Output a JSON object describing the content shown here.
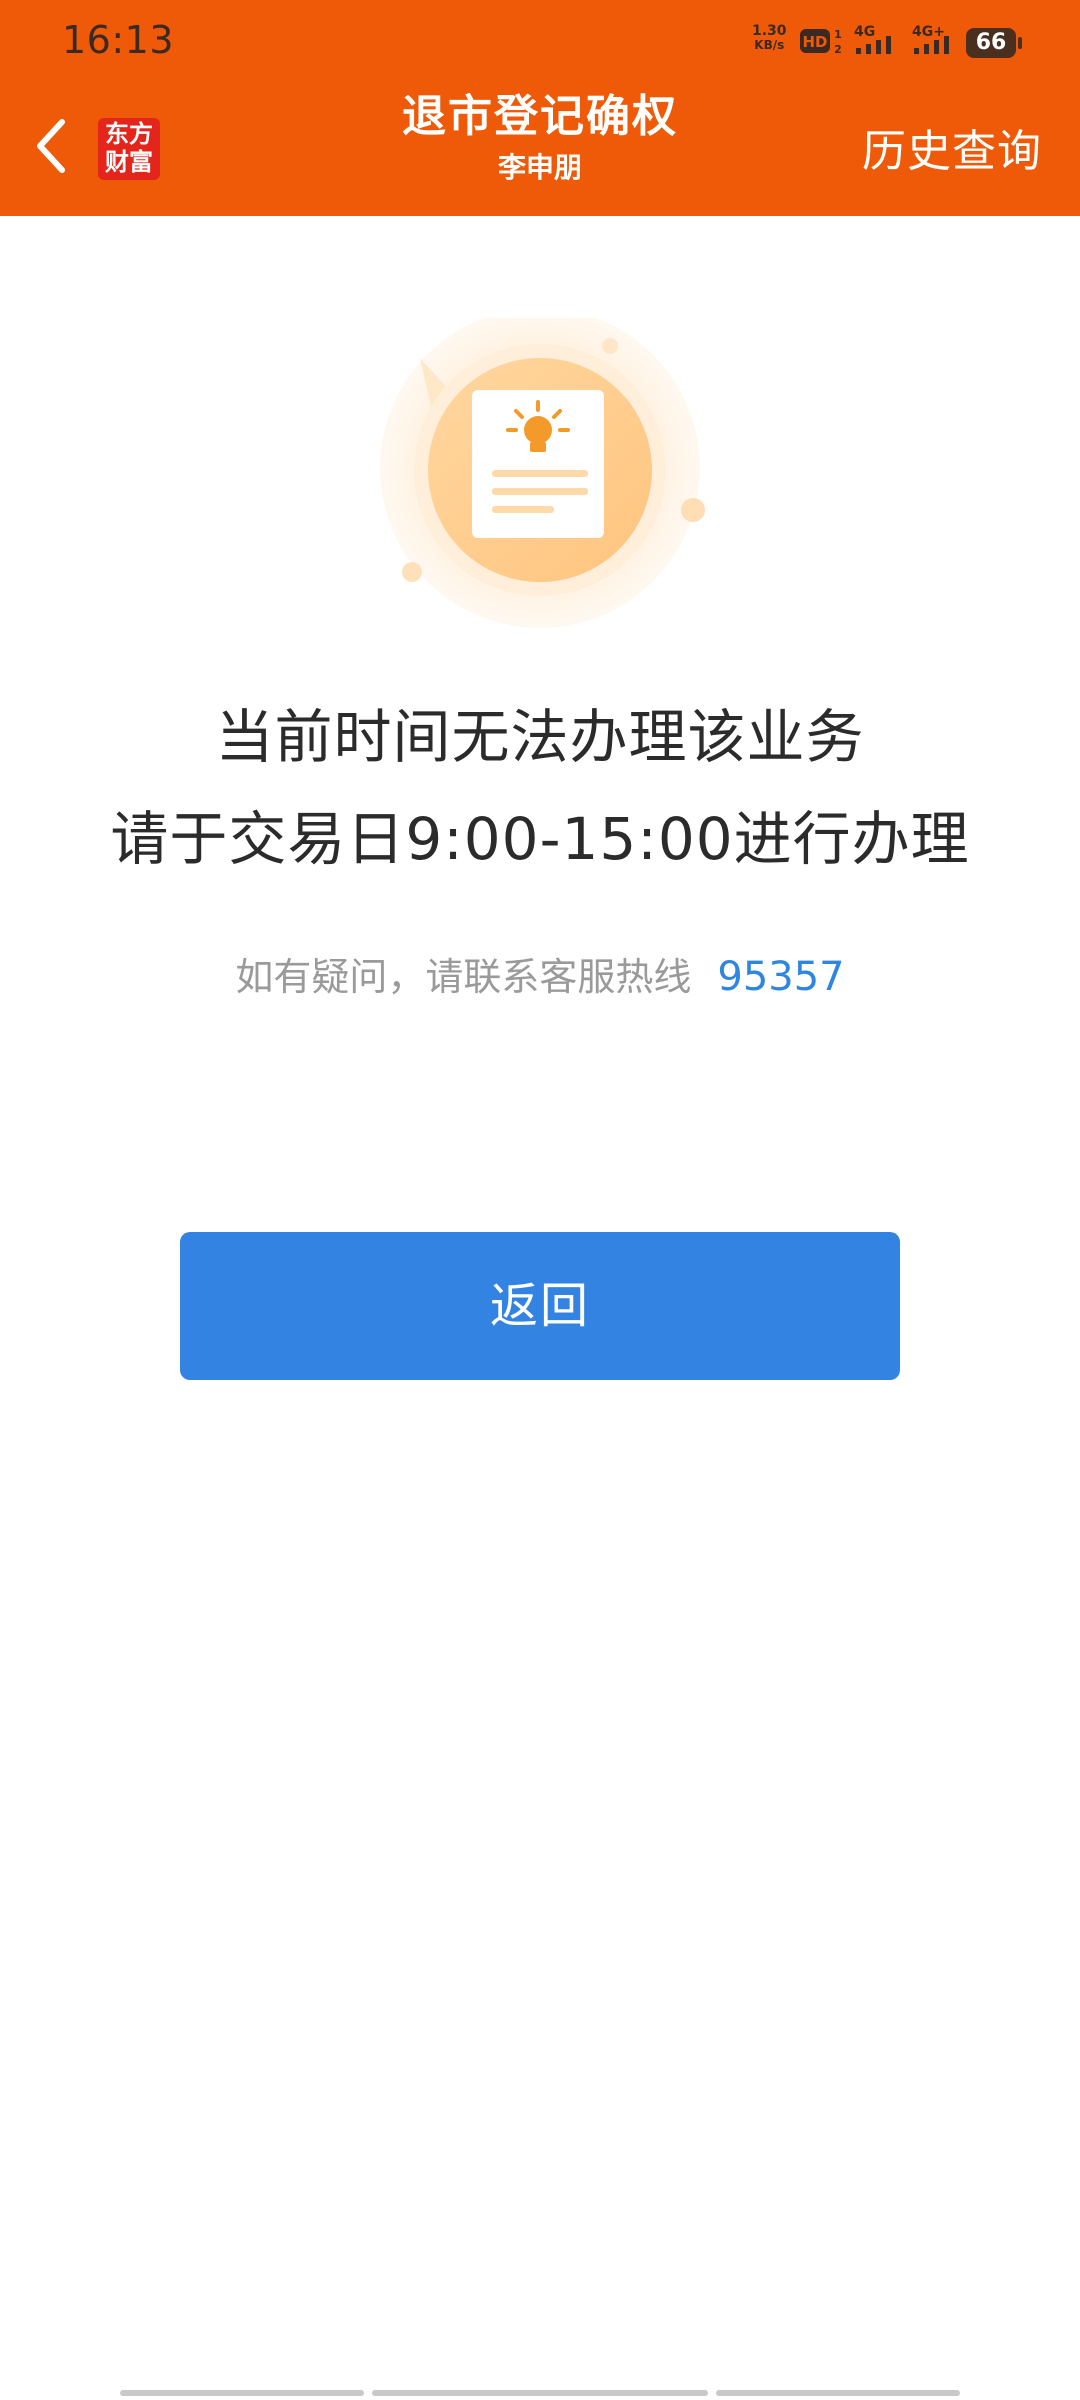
{
  "status_bar": {
    "time": "16:13",
    "net_speed_value": "1.30",
    "net_speed_unit": "KB/s",
    "network_1": "4G",
    "network_2": "4G+",
    "battery_level": "66",
    "icons": [
      "hd-call-icon",
      "signal-icon",
      "signal-icon",
      "battery-icon"
    ]
  },
  "header": {
    "back_icon": "chevron-left-icon",
    "logo_line1": "东方",
    "logo_line2": "财富",
    "title": "退市登记确权",
    "subtitle": "李申朋",
    "history_label": "历史查询"
  },
  "main": {
    "illustration_icon": "document-lightbulb-icon",
    "message_line1": "当前时间无法办理该业务",
    "message_line2": "请于交易日9:00-15:00进行办理",
    "contact_label": "如有疑问，请联系客服热线",
    "hotline": "95357",
    "return_label": "返回"
  },
  "colors": {
    "header_bg": "#EE5A07",
    "logo_bg": "#E3251B",
    "primary_button": "#3384E2",
    "hotline_link": "#2F86DE",
    "message_text": "#2B2B2B",
    "hint_text": "#9A9A9A"
  }
}
